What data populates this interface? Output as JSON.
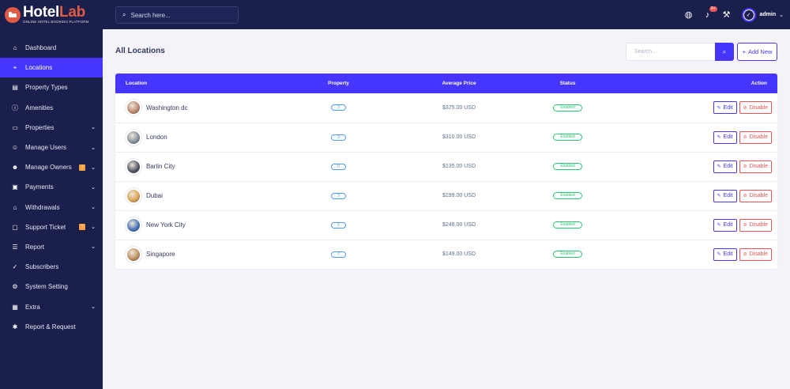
{
  "brand": {
    "name_part1": "Hotel",
    "name_part2": "Lab",
    "tagline": "ONLINE HOTEL BOOKING PLATFORM",
    "accent_color": "#e05a44"
  },
  "topbar": {
    "search_placeholder": "Search here...",
    "notification_badge": "9+",
    "admin_name": "admin"
  },
  "sidebar": {
    "items": [
      {
        "label": "Dashboard",
        "icon": "home-icon",
        "glyph": "⌂",
        "active": false,
        "badge": "",
        "chevron": false
      },
      {
        "label": "Locations",
        "icon": "map-pin-icon",
        "glyph": "⌖",
        "active": true,
        "badge": "",
        "chevron": false
      },
      {
        "label": "Property Types",
        "icon": "building-icon",
        "glyph": "▤",
        "active": false,
        "badge": "",
        "chevron": false
      },
      {
        "label": "Amenities",
        "icon": "info-icon",
        "glyph": "ⓘ",
        "active": false,
        "badge": "",
        "chevron": false
      },
      {
        "label": "Properties",
        "icon": "bed-icon",
        "glyph": "▭",
        "active": false,
        "badge": "",
        "chevron": true
      },
      {
        "label": "Manage Users",
        "icon": "users-icon",
        "glyph": "☺",
        "active": false,
        "badge": "",
        "chevron": true
      },
      {
        "label": "Manage Owners",
        "icon": "owners-icon",
        "glyph": "☻",
        "active": false,
        "badge": "!",
        "chevron": true
      },
      {
        "label": "Payments",
        "icon": "payment-icon",
        "glyph": "▣",
        "active": false,
        "badge": "",
        "chevron": true
      },
      {
        "label": "Withdrawals",
        "icon": "bank-icon",
        "glyph": "⌂",
        "active": false,
        "badge": "",
        "chevron": true
      },
      {
        "label": "Support Ticket",
        "icon": "ticket-icon",
        "glyph": "▢",
        "active": false,
        "badge": "!",
        "chevron": true
      },
      {
        "label": "Report",
        "icon": "list-icon",
        "glyph": "☰",
        "active": false,
        "badge": "",
        "chevron": true
      },
      {
        "label": "Subscribers",
        "icon": "thumbs-up-icon",
        "glyph": "✓",
        "active": false,
        "badge": "",
        "chevron": false
      },
      {
        "label": "System Setting",
        "icon": "gear-icon",
        "glyph": "⚙",
        "active": false,
        "badge": "",
        "chevron": false
      },
      {
        "label": "Extra",
        "icon": "layers-icon",
        "glyph": "▦",
        "active": false,
        "badge": "",
        "chevron": true
      },
      {
        "label": "Report & Request",
        "icon": "bug-icon",
        "glyph": "✱",
        "active": false,
        "badge": "",
        "chevron": false
      }
    ]
  },
  "main": {
    "page_title": "All Locations",
    "search_placeholder": "Search...",
    "add_new_label": "Add New",
    "table": {
      "headers": [
        "Location",
        "Property",
        "Average Price",
        "Status",
        "Action"
      ],
      "rows": [
        {
          "location": "Washington dc",
          "property": "3",
          "avg_price": "$375.00 USD",
          "status": "Enabled",
          "thumb_color": "#b7826a"
        },
        {
          "location": "London",
          "property": "3",
          "avg_price": "$310.00 USD",
          "status": "Enabled",
          "thumb_color": "#7d8c99"
        },
        {
          "location": "Barlin City",
          "property": "0",
          "avg_price": "$135.00 USD",
          "status": "Enabled",
          "thumb_color": "#4a4f5e"
        },
        {
          "location": "Dubai",
          "property": "3",
          "avg_price": "$199.00 USD",
          "status": "Enabled",
          "thumb_color": "#d7a04e"
        },
        {
          "location": "New York City",
          "property": "5",
          "avg_price": "$248.00 USD",
          "status": "Enabled",
          "thumb_color": "#3f6bb3"
        },
        {
          "location": "Singapore",
          "property": "7",
          "avg_price": "$149.00 USD",
          "status": "Enabled",
          "thumb_color": "#b98a5a"
        }
      ],
      "edit_label": "Edit",
      "disable_label": "Disable"
    }
  },
  "colors": {
    "sidebar_bg": "#1b1f4b",
    "primary": "#4634ff",
    "success": "#28c76f",
    "danger": "#ea5455",
    "info": "#4e9cf5"
  }
}
